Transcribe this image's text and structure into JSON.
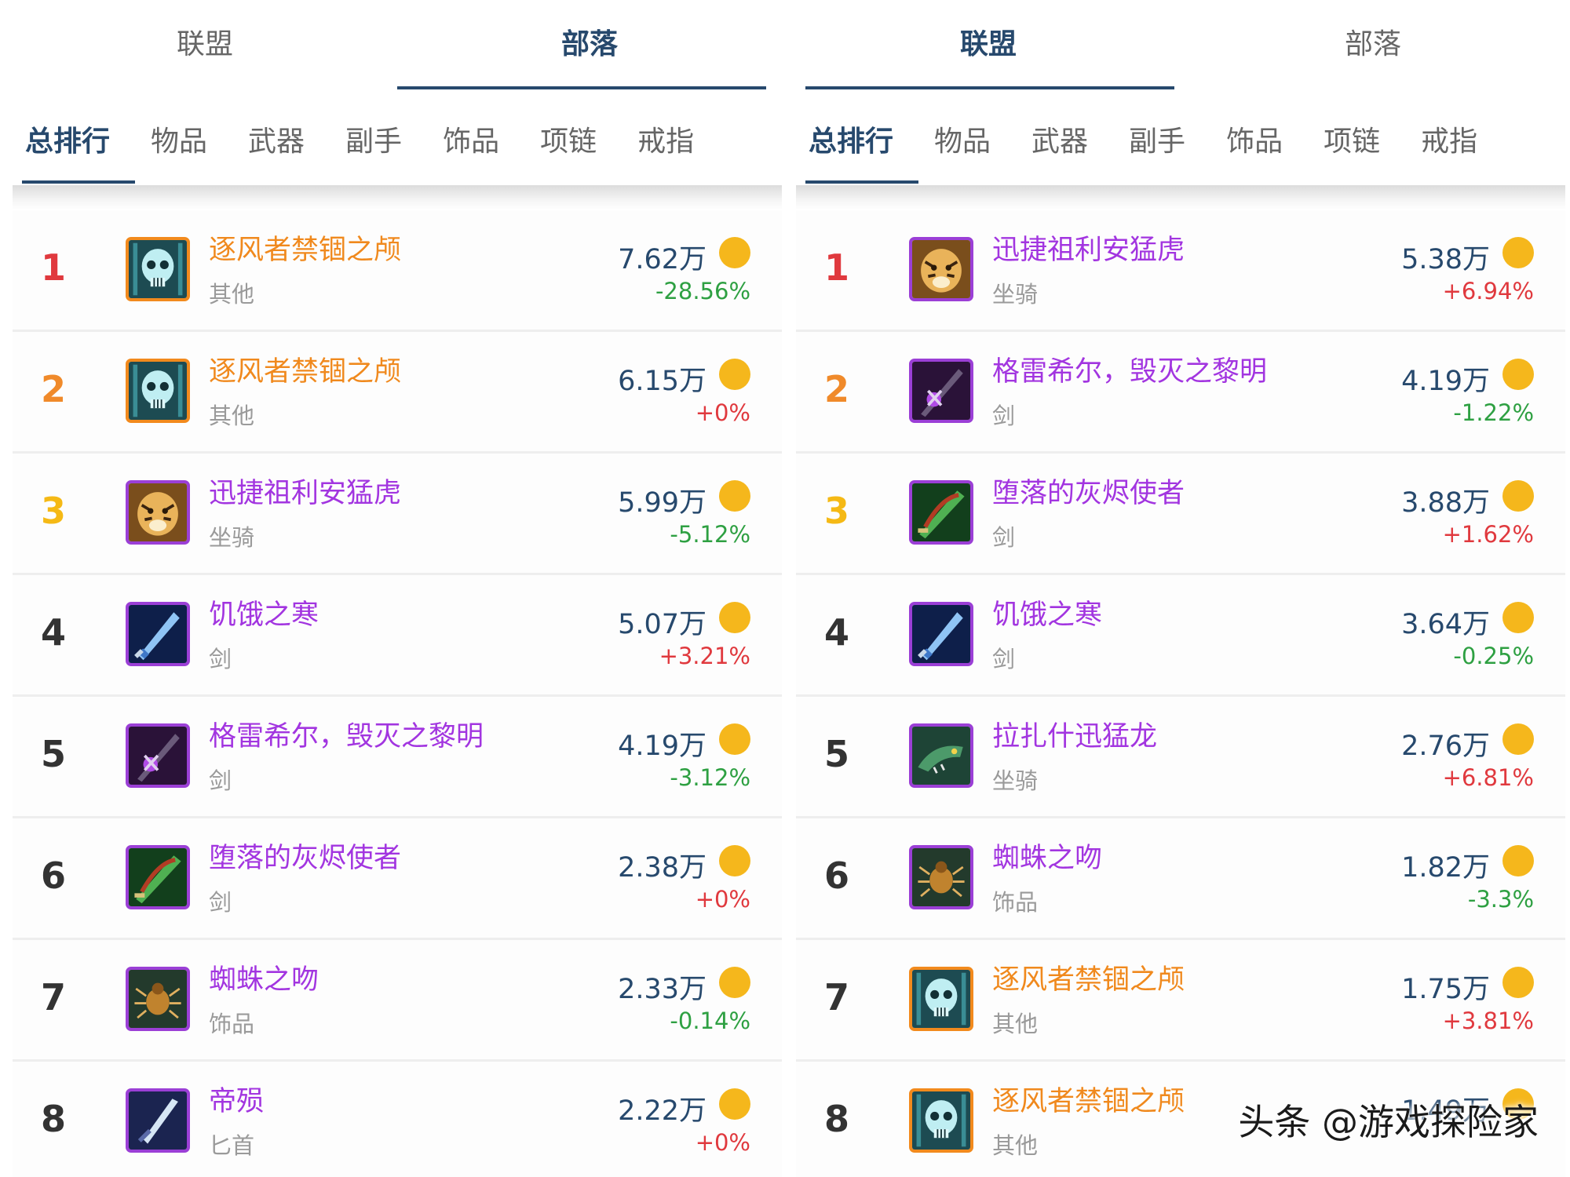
{
  "left": {
    "faction_tabs": [
      "联盟",
      "部落"
    ],
    "active_faction": 1,
    "category_tabs": [
      "总排行",
      "物品",
      "武器",
      "副手",
      "饰品",
      "项链",
      "戒指"
    ],
    "rows": [
      {
        "rank": "1",
        "name": "逐风者禁锢之颅",
        "sub": "其他",
        "price": "7.62万",
        "change": "-28.56%",
        "dir": "neg",
        "quality": "orange",
        "icon": "skull-icon"
      },
      {
        "rank": "2",
        "name": "逐风者禁锢之颅",
        "sub": "其他",
        "price": "6.15万",
        "change": "+0%",
        "dir": "pos",
        "quality": "orange",
        "icon": "skull-icon"
      },
      {
        "rank": "3",
        "name": "迅捷祖利安猛虎",
        "sub": "坐骑",
        "price": "5.99万",
        "change": "-5.12%",
        "dir": "neg",
        "quality": "purple",
        "icon": "tiger-icon"
      },
      {
        "rank": "4",
        "name": "饥饿之寒",
        "sub": "剑",
        "price": "5.07万",
        "change": "+3.21%",
        "dir": "pos",
        "quality": "purple",
        "icon": "blue-sword-icon"
      },
      {
        "rank": "5",
        "name": "格雷希尔，毁灭之黎明",
        "sub": "剑",
        "price": "4.19万",
        "change": "-3.12%",
        "dir": "neg",
        "quality": "purple",
        "icon": "dark-sword-icon"
      },
      {
        "rank": "6",
        "name": "堕落的灰烬使者",
        "sub": "剑",
        "price": "2.38万",
        "change": "+0%",
        "dir": "pos",
        "quality": "purple",
        "icon": "green-sword-icon"
      },
      {
        "rank": "7",
        "name": "蜘蛛之吻",
        "sub": "饰品",
        "price": "2.33万",
        "change": "-0.14%",
        "dir": "neg",
        "quality": "purple",
        "icon": "spider-icon"
      },
      {
        "rank": "8",
        "name": "帝殒",
        "sub": "匕首",
        "price": "2.22万",
        "change": "+0%",
        "dir": "pos",
        "quality": "purple",
        "icon": "dagger-icon"
      }
    ]
  },
  "right": {
    "faction_tabs": [
      "联盟",
      "部落"
    ],
    "active_faction": 0,
    "category_tabs": [
      "总排行",
      "物品",
      "武器",
      "副手",
      "饰品",
      "项链",
      "戒指"
    ],
    "rows": [
      {
        "rank": "1",
        "name": "迅捷祖利安猛虎",
        "sub": "坐骑",
        "price": "5.38万",
        "change": "+6.94%",
        "dir": "pos",
        "quality": "purple",
        "icon": "tiger-icon"
      },
      {
        "rank": "2",
        "name": "格雷希尔，毁灭之黎明",
        "sub": "剑",
        "price": "4.19万",
        "change": "-1.22%",
        "dir": "neg",
        "quality": "purple",
        "icon": "dark-sword-icon"
      },
      {
        "rank": "3",
        "name": "堕落的灰烬使者",
        "sub": "剑",
        "price": "3.88万",
        "change": "+1.62%",
        "dir": "pos",
        "quality": "purple",
        "icon": "green-sword-icon"
      },
      {
        "rank": "4",
        "name": "饥饿之寒",
        "sub": "剑",
        "price": "3.64万",
        "change": "-0.25%",
        "dir": "neg",
        "quality": "purple",
        "icon": "blue-sword-icon"
      },
      {
        "rank": "5",
        "name": "拉扎什迅猛龙",
        "sub": "坐骑",
        "price": "2.76万",
        "change": "+6.81%",
        "dir": "pos",
        "quality": "purple",
        "icon": "raptor-icon"
      },
      {
        "rank": "6",
        "name": "蜘蛛之吻",
        "sub": "饰品",
        "price": "1.82万",
        "change": "-3.3%",
        "dir": "neg",
        "quality": "purple",
        "icon": "spider-icon"
      },
      {
        "rank": "7",
        "name": "逐风者禁锢之颅",
        "sub": "其他",
        "price": "1.75万",
        "change": "+3.81%",
        "dir": "pos",
        "quality": "orange",
        "icon": "skull-icon"
      },
      {
        "rank": "8",
        "name": "逐风者禁锢之颅",
        "sub": "其他",
        "price": "1.49万",
        "change": "",
        "dir": "pos",
        "quality": "orange",
        "icon": "skull-icon"
      }
    ]
  },
  "watermark": "头条 @游戏探险家",
  "colors": {
    "accent": "#27496d",
    "purple": "#a235e0",
    "orange": "#f0891d",
    "up": "#e0393e",
    "down": "#2ea042",
    "coin": "#f5b71c"
  }
}
